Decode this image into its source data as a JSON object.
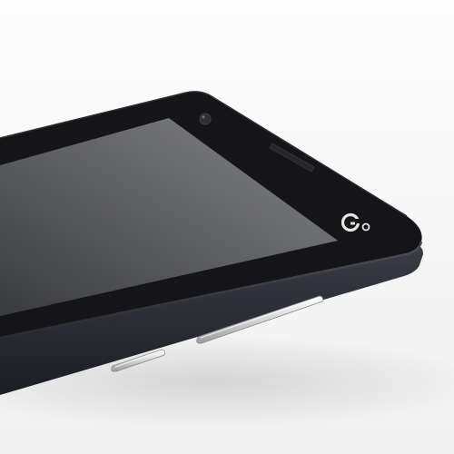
{
  "scene": {
    "subject": "smartphone-corner-closeup",
    "colors": {
      "background_light": "#fbfbfb",
      "background_shadow": "#e6e6e6",
      "body_side": "#2a2c34",
      "body_side_dark": "#1b1c22",
      "bezel": "#141417",
      "bezel_edge": "#3a3a40",
      "screen_dark": "#3a3b3f",
      "screen_light": "#7b7c7f",
      "button_silver": "#dcdcdc",
      "button_highlight": "#ffffff",
      "logo": "#e4e4e4"
    },
    "icons": {
      "logo": "carrier-logo-icon",
      "camera": "front-camera-icon",
      "speaker": "earpiece-speaker-icon"
    },
    "controls": {
      "volume_rocker": "volume-rocker-button",
      "power_key": "power-key-button"
    }
  }
}
